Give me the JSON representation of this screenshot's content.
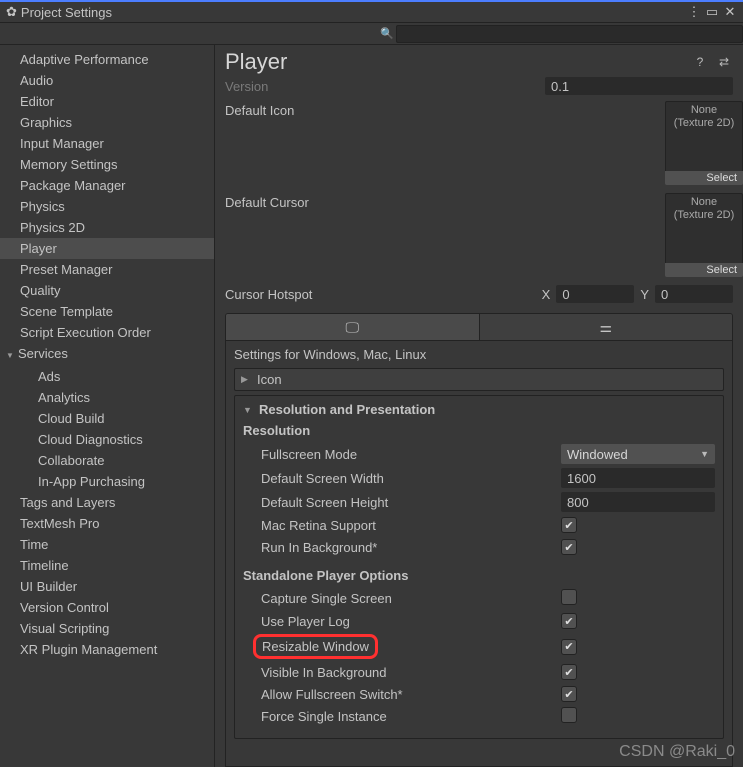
{
  "window": {
    "title": "Project Settings"
  },
  "search": {
    "value": ""
  },
  "sidebar": {
    "items": [
      {
        "label": "Adaptive Performance"
      },
      {
        "label": "Audio"
      },
      {
        "label": "Editor"
      },
      {
        "label": "Graphics"
      },
      {
        "label": "Input Manager"
      },
      {
        "label": "Memory Settings"
      },
      {
        "label": "Package Manager"
      },
      {
        "label": "Physics"
      },
      {
        "label": "Physics 2D"
      },
      {
        "label": "Player",
        "selected": true
      },
      {
        "label": "Preset Manager"
      },
      {
        "label": "Quality"
      },
      {
        "label": "Scene Template"
      },
      {
        "label": "Script Execution Order"
      },
      {
        "label": "Services",
        "expander": true
      },
      {
        "label": "Ads",
        "child": true
      },
      {
        "label": "Analytics",
        "child": true
      },
      {
        "label": "Cloud Build",
        "child": true
      },
      {
        "label": "Cloud Diagnostics",
        "child": true
      },
      {
        "label": "Collaborate",
        "child": true
      },
      {
        "label": "In-App Purchasing",
        "child": true
      },
      {
        "label": "Tags and Layers"
      },
      {
        "label": "TextMesh Pro"
      },
      {
        "label": "Time"
      },
      {
        "label": "Timeline"
      },
      {
        "label": "UI Builder"
      },
      {
        "label": "Version Control"
      },
      {
        "label": "Visual Scripting"
      },
      {
        "label": "XR Plugin Management"
      }
    ]
  },
  "header": {
    "title": "Player"
  },
  "fields": {
    "version_label": "Version",
    "version_value": "0.1",
    "default_icon_label": "Default Icon",
    "default_cursor_label": "Default Cursor",
    "none_label": "None",
    "texture2d_label": "(Texture 2D)",
    "select_label": "Select",
    "cursor_hotspot_label": "Cursor Hotspot",
    "x_label": "X",
    "y_label": "Y",
    "x_value": "0",
    "y_value": "0"
  },
  "panel": {
    "settings_for": "Settings for Windows, Mac, Linux",
    "icon_fold": "Icon",
    "resolution_fold": "Resolution and Presentation",
    "resolution_head": "Resolution",
    "fullscreen_mode_label": "Fullscreen Mode",
    "fullscreen_mode_value": "Windowed",
    "default_width_label": "Default Screen Width",
    "default_width_value": "1600",
    "default_height_label": "Default Screen Height",
    "default_height_value": "800",
    "mac_retina_label": "Mac Retina Support",
    "run_bg_label": "Run In Background*",
    "standalone_head": "Standalone Player Options",
    "capture_single_label": "Capture Single Screen",
    "use_player_log_label": "Use Player Log",
    "resizable_window_label": "Resizable Window",
    "visible_bg_label": "Visible In Background",
    "allow_fullscreen_label": "Allow Fullscreen Switch*",
    "force_single_label": "Force Single Instance"
  },
  "watermark": "CSDN @Raki_0"
}
